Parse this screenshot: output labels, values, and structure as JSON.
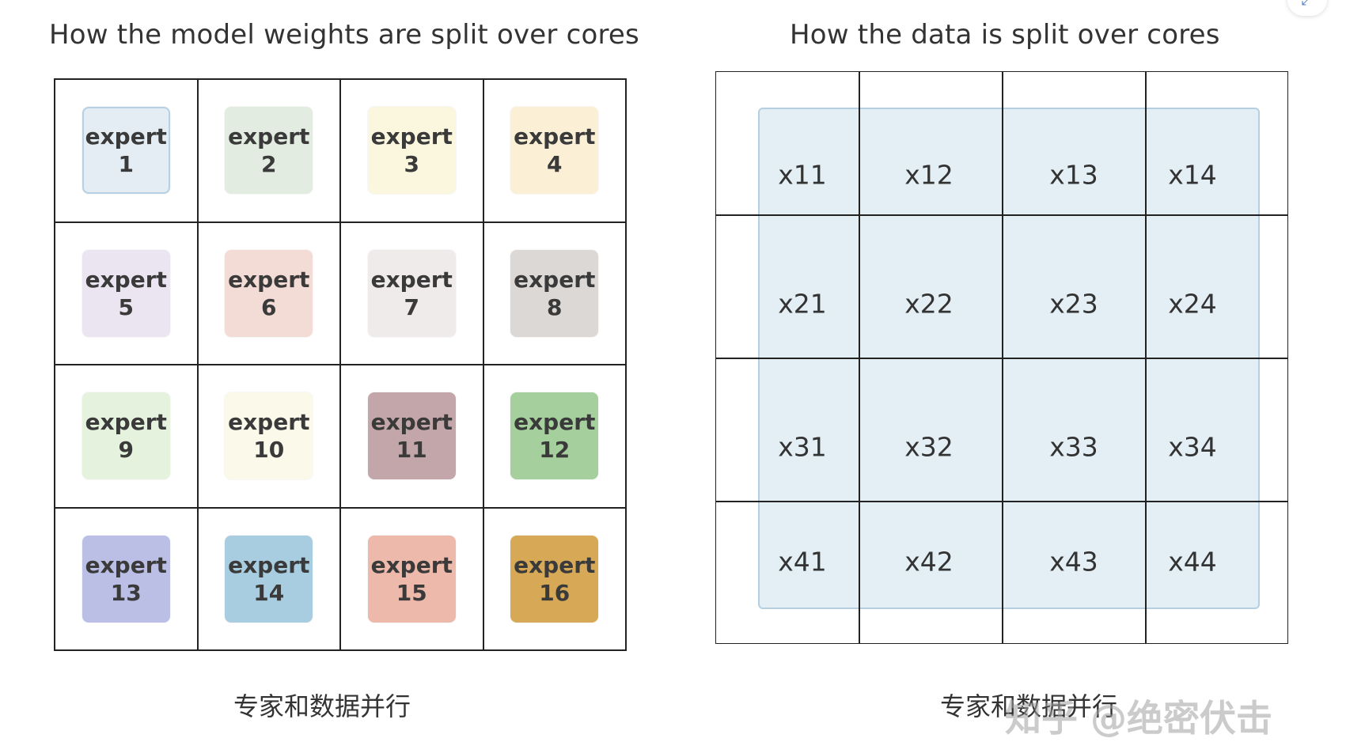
{
  "left_title": "How the model weights are split over cores",
  "right_title": "How the data is split over cores",
  "experts": [
    {
      "word": "expert",
      "num": "1",
      "color": "#e3edf3",
      "border": "#b7d0e3"
    },
    {
      "word": "expert",
      "num": "2",
      "color": "#e3ece1",
      "border": "#e3ece1"
    },
    {
      "word": "expert",
      "num": "3",
      "color": "#fbf7de",
      "border": "#fbf7de"
    },
    {
      "word": "expert",
      "num": "4",
      "color": "#fbefd6",
      "border": "#fbefd6"
    },
    {
      "word": "expert",
      "num": "5",
      "color": "#ebe5f1",
      "border": "#ebe5f1"
    },
    {
      "word": "expert",
      "num": "6",
      "color": "#f4dcd6",
      "border": "#f4dcd6"
    },
    {
      "word": "expert",
      "num": "7",
      "color": "#efebea",
      "border": "#efebea"
    },
    {
      "word": "expert",
      "num": "8",
      "color": "#dcd8d6",
      "border": "#dcd8d6"
    },
    {
      "word": "expert",
      "num": "9",
      "color": "#e5f3de",
      "border": "#e5f3de"
    },
    {
      "word": "expert",
      "num": "10",
      "color": "#fbf9e9",
      "border": "#fbf9e9"
    },
    {
      "word": "expert",
      "num": "11",
      "color": "#c3a6aa",
      "border": "#c3a6aa"
    },
    {
      "word": "expert",
      "num": "12",
      "color": "#a5cf9c",
      "border": "#a5cf9c"
    },
    {
      "word": "expert",
      "num": "13",
      "color": "#bbbfe6",
      "border": "#bbbfe6"
    },
    {
      "word": "expert",
      "num": "14",
      "color": "#a9cde0",
      "border": "#a9cde0"
    },
    {
      "word": "expert",
      "num": "15",
      "color": "#ecb9aa",
      "border": "#ecb9aa"
    },
    {
      "word": "expert",
      "num": "16",
      "color": "#d7a957",
      "border": "#d7a957"
    }
  ],
  "data_cells": [
    [
      "x11",
      "x12",
      "x13",
      "x14"
    ],
    [
      "x21",
      "x22",
      "x23",
      "x24"
    ],
    [
      "x31",
      "x32",
      "x33",
      "x34"
    ],
    [
      "x41",
      "x42",
      "x43",
      "x44"
    ]
  ],
  "left_caption": "专家和数据并行",
  "right_caption": "专家和数据并行",
  "watermark": "知乎 @绝密伏击",
  "data_panel_color": "#d2e4ee"
}
